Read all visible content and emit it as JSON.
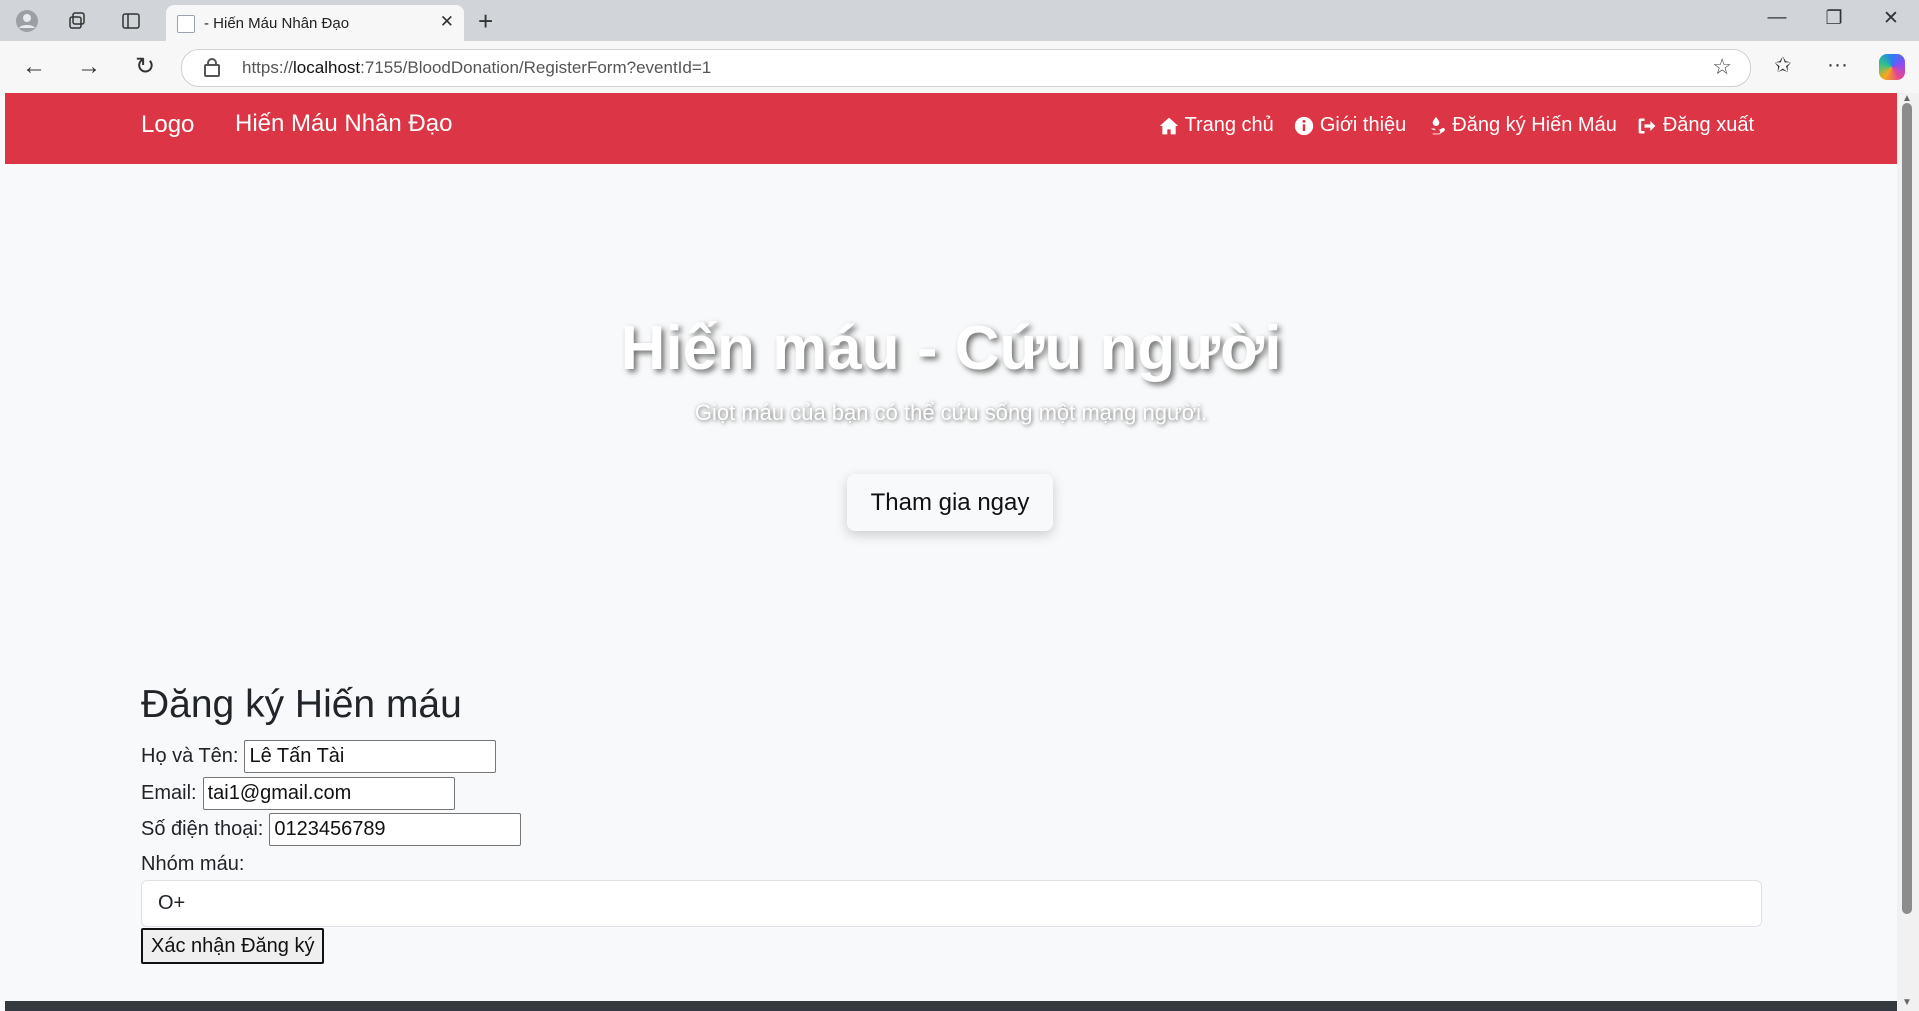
{
  "browser": {
    "tab_title": "- Hiến Máu Nhân Đạo",
    "url_prefix": "https://",
    "url_host": "localhost",
    "url_rest": ":7155/BloodDonation/RegisterForm?eventId=1"
  },
  "navbar": {
    "logo_alt": "Logo",
    "brand": "Hiến Máu Nhân Đạo",
    "links": [
      {
        "label": "Trang chủ",
        "icon": "home-icon"
      },
      {
        "label": "Giới thiệu",
        "icon": "info-icon"
      },
      {
        "label": "Đăng ký Hiến Máu",
        "icon": "donate-icon"
      },
      {
        "label": "Đăng xuất",
        "icon": "logout-icon"
      }
    ]
  },
  "hero": {
    "title": "Hiến máu - Cứu người",
    "subtitle": "Giọt máu của bạn có thể cứu sống một mạng người.",
    "cta": "Tham gia ngay"
  },
  "form": {
    "title": "Đăng ký Hiến máu",
    "name_label": "Họ và Tên:",
    "name_value": "Lê Tấn Tài",
    "email_label": "Email:",
    "email_value": "tai1@gmail.com",
    "phone_label": "Số điện thoại:",
    "phone_value": "0123456789",
    "blood_label": "Nhóm máu:",
    "blood_value": "O+",
    "submit": "Xác nhận Đăng ký"
  }
}
